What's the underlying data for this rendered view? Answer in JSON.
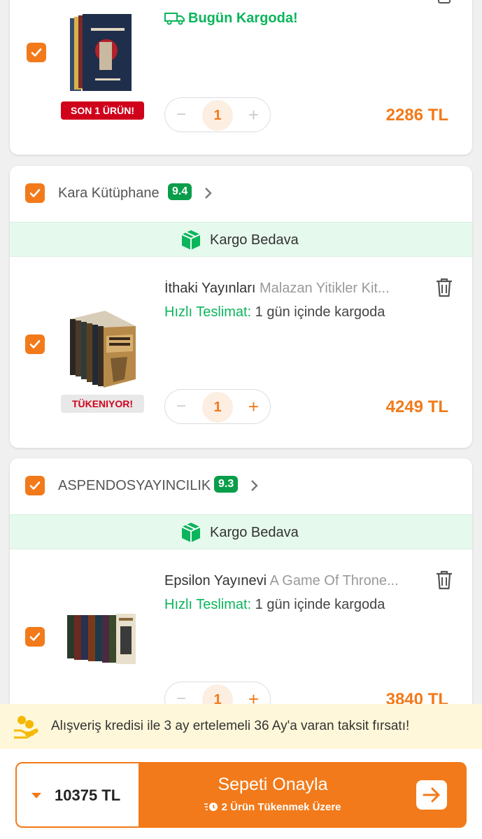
{
  "items": [
    {
      "badge": "SON 1 ÜRÜN!",
      "shipping_note": "Bugün Kargoda!",
      "quantity": "1",
      "price": "2286 TL"
    },
    {
      "seller": "Kara Kütüphane",
      "rating": "9.4",
      "shipping_banner": "Kargo Bedava",
      "brand": "İthaki Yayınları",
      "name": "Malazan Yitikler Kit...",
      "delivery_label": "Hızlı Teslimat:",
      "delivery_text": "1 gün içinde kargoda",
      "badge": "TÜKENIYOR!",
      "quantity": "1",
      "price": "4249 TL"
    },
    {
      "seller": "ASPENDOSYAYINCILIK",
      "rating": "9.3",
      "shipping_banner": "Kargo Bedava",
      "brand": "Epsilon Yayınevi",
      "name": "A Game Of Throne...",
      "delivery_label": "Hızlı Teslimat:",
      "delivery_text": "1 gün içinde kargoda",
      "quantity": "1",
      "price": "3840 TL"
    }
  ],
  "promo": {
    "text": "Alışveriş kredisi ile 3 ay ertelemeli 36 Ay'a varan taksit fırsatı!"
  },
  "footer": {
    "total": "10375 TL",
    "confirm_label": "Sepeti Onayla",
    "confirm_sub": "2 Ürün Tükenmek Üzere"
  },
  "colors": {
    "accent": "#f27a1a",
    "green": "#0bb55c",
    "rating": "#0a9d4a"
  }
}
